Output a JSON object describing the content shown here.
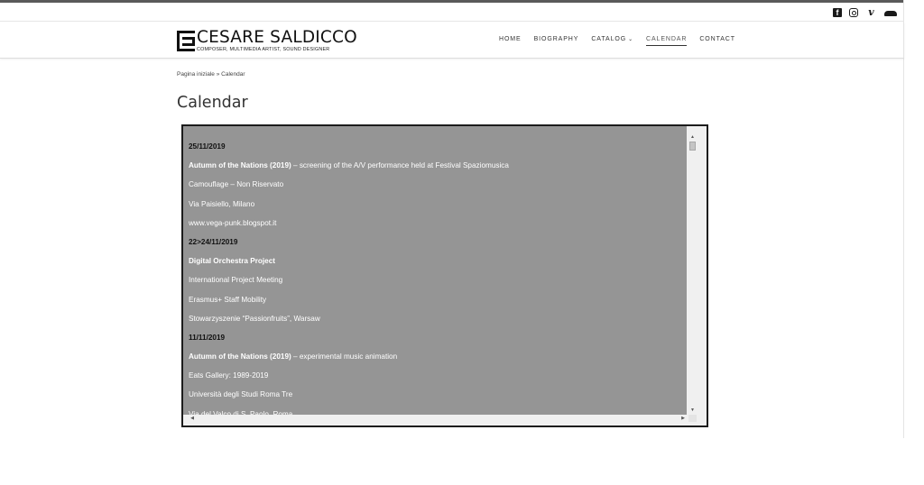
{
  "social": {
    "icons": [
      "facebook-icon",
      "instagram-icon",
      "vimeo-icon",
      "soundcloud-icon"
    ],
    "facebook_glyph": "f",
    "vimeo_glyph": "v"
  },
  "header": {
    "logo_title": "CESARE SALDICCO",
    "logo_subtitle": "COMPOSER, MULTIMEDIA ARTIST, SOUND DESIGNER",
    "nav": {
      "home": "HOME",
      "biography": "BIOGRAPHY",
      "catalog": "CATALOG",
      "catalog_chevron": "⌄",
      "calendar": "CALENDAR",
      "contact": "CONTACT"
    }
  },
  "breadcrumb": "Pagina iniziale » Calendar",
  "page_title": "Calendar",
  "calendar": {
    "lines": [
      {
        "type": "date",
        "text": "25/11/2019"
      },
      {
        "type": "event",
        "bold": "Autumn of the Nations (2019)",
        "text": " – screening of the A/V performance held at Festival Spaziomusica"
      },
      {
        "type": "text",
        "text": "Camouflage – Non Riservato"
      },
      {
        "type": "text",
        "text": "Via Paisiello, Milano"
      },
      {
        "type": "text",
        "text": "www.vega-punk.blogspot.it"
      },
      {
        "type": "date",
        "text": "22>24/11/2019"
      },
      {
        "type": "event",
        "bold": "Digital Orchestra Project",
        "text": ""
      },
      {
        "type": "text",
        "text": "International Project Meeting"
      },
      {
        "type": "text",
        "text": "Erasmus+ Staff Mobility"
      },
      {
        "type": "text",
        "text": "Stowarzyszenie “Passionfruits”, Warsaw"
      },
      {
        "type": "date",
        "text": "11/11/2019"
      },
      {
        "type": "event",
        "bold": "Autumn of the Nations (2019)",
        "text": " – experimental music animation"
      },
      {
        "type": "text",
        "text": "Eats Gallery: 1989-2019"
      },
      {
        "type": "text",
        "text": "Università degli Studi Roma Tre"
      },
      {
        "type": "text",
        "text": "Via del Valco di S. Paolo, Roma"
      }
    ],
    "colors": {
      "background": "#959595",
      "text": "#ffffff",
      "date_text": "#111111"
    }
  }
}
